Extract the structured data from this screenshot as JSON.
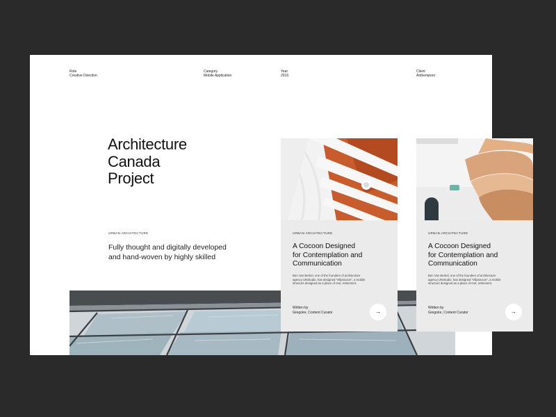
{
  "meta": [
    {
      "label": "Role",
      "value": "Creative Direction"
    },
    {
      "label": "Category",
      "value": "Mobile Application"
    },
    {
      "label": "Year",
      "value": "2016"
    },
    {
      "label": "Client",
      "value": "Anthempoor"
    }
  ],
  "hero": {
    "title_lines": [
      "Architecture",
      "Canada",
      "Project"
    ],
    "eyebrow": "URBAN ARCHITECTURE",
    "lead": "Fully thought and digitally developed and hand-woven by highly skilled"
  },
  "cards": [
    {
      "eyebrow": "URBAN ARCHITECTURE",
      "title_lines": [
        "A Cocoon Designed",
        "for Contemplation and",
        "Communication"
      ],
      "body": "Ben Van Berkel, one of the founders of architecture agency UNStudio, has designed \"ellipsicoon\", a mobile structure designed as a place of rest, retirement.",
      "byline_label": "Written by",
      "byline_name": "Gregoire, Content Curator",
      "arrow": "→"
    },
    {
      "eyebrow": "URBAN ARCHITECTURE",
      "title_lines": [
        "A Cocoon Designed",
        "for Contemplation and",
        "Communication"
      ],
      "body": "Ben Van Berkel, one of the founders of architecture agency UNStudio, has designed \"ellipsicoon\", a mobile structure designed as a place of rest, retirement.",
      "byline_label": "Written by",
      "byline_name": "Gregoire, Content Curator",
      "arrow": "→"
    }
  ]
}
